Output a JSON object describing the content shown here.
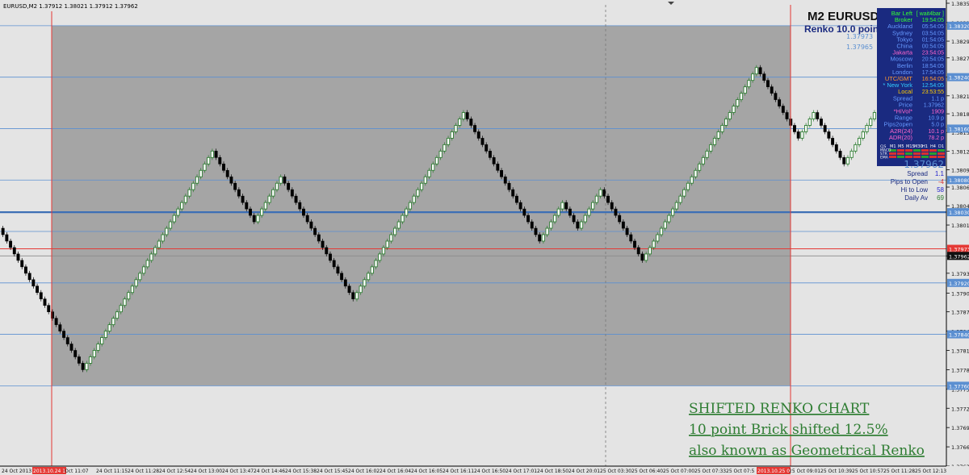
{
  "header": {
    "symbol_line": "EURUSD,M2  1.37912 1.38021 1.37912 1.37962",
    "title": "M2 EURUSD",
    "subtitle": "Renko 10.0 point"
  },
  "annotation": {
    "lines": [
      "SHIFTED RENKO CHART",
      "10 point Brick shifted 12.5%",
      "also known as Geometrical Renko"
    ]
  },
  "info_panel": {
    "rows": [
      {
        "label": "Bar Left",
        "value": "[ wait4bar ]",
        "color": "#33ff33"
      },
      {
        "label": "Broker",
        "value": "19:54:05",
        "color": "#33ff33"
      },
      {
        "label": "Auckland",
        "value": "05:54:05",
        "color": "#6699ff"
      },
      {
        "label": "Sydney",
        "value": "03:54:05",
        "color": "#6699ff"
      },
      {
        "label": "Tokyo",
        "value": "01:54:05",
        "color": "#6699ff"
      },
      {
        "label": "China",
        "value": "00:54:05",
        "color": "#6699ff"
      },
      {
        "label": "Jakarta",
        "value": "23:54:05",
        "color": "#ff66cc"
      },
      {
        "label": "Moscow",
        "value": "20:54:05",
        "color": "#6699ff"
      },
      {
        "label": "Berlin",
        "value": "18:54:05",
        "color": "#6699ff"
      },
      {
        "label": "London",
        "value": "17:54:05",
        "color": "#6699ff"
      },
      {
        "label": "UTC/GMT",
        "value": "16:54:05",
        "color": "#ff9933"
      },
      {
        "label": "* New York",
        "value": "12:54:05",
        "color": "#33ccff"
      },
      {
        "label": "Local",
        "value": "23:53:55",
        "color": "#ffcc00"
      },
      {
        "label": "Spread",
        "value": "1.1 p",
        "color": "#6699ff"
      },
      {
        "label": "Price",
        "value": "1.37962",
        "color": "#6699ff"
      },
      {
        "label": "*HiVol*",
        "value": "1909",
        "color": "#ff66cc"
      },
      {
        "label": "Range",
        "value": "10.9 p",
        "color": "#6699ff"
      },
      {
        "label": "Pips2open",
        "value": "5.0 p",
        "color": "#6699ff"
      },
      {
        "label": "A2R(24)",
        "value": "10.1 p",
        "color": "#ff66cc"
      },
      {
        "label": "ADR(20)",
        "value": "78.2 p",
        "color": "#ff66cc"
      }
    ],
    "timeframes": [
      "M1",
      "M5",
      "M15",
      "M30",
      "H1",
      "H4",
      "D1"
    ],
    "indicators": [
      "CJS",
      "MACD",
      "STR",
      "EMA"
    ],
    "price": "1.37962",
    "stats": [
      {
        "label": "Spread",
        "value": "1.1"
      },
      {
        "label": "Pips to Open",
        "value": "-4"
      },
      {
        "label": "Hi to Low",
        "value": "58"
      },
      {
        "label": "Daily Av",
        "value": "69"
      }
    ],
    "small_prices": [
      "1.37973",
      "1.37965"
    ]
  },
  "colors": {
    "background": "#e4e4e4",
    "shaded": "#a5a5a5",
    "bull_fill": "#ffffff",
    "bull_border": "#2e7d32",
    "bear": "#000000",
    "grid_blue": "#5b8fd1",
    "level_red": "#e53935",
    "annotation": "#2e7d32",
    "panel_bg": "#1a2a80"
  },
  "chart_data": {
    "type": "renko",
    "symbol": "EURUSD",
    "timeframe": "M2",
    "brick_size_points": 10,
    "brick_shift_percent": 12.5,
    "ylim": [
      1.37635,
      1.38355
    ],
    "y_ticks": [
      "1.38355",
      "1.38325",
      "1.38296",
      "1.38270",
      "1.38240",
      "1.38211",
      "1.38183",
      "1.38154",
      "1.38125",
      "1.38096",
      "1.38069",
      "1.38040",
      "1.38010",
      "1.37962",
      "1.37935",
      "1.37904",
      "1.37875",
      "1.37845",
      "1.37815",
      "1.37785",
      "1.37755",
      "1.37725",
      "1.37695",
      "1.37665",
      "1.37635"
    ],
    "y_tick_values": [
      1.38355,
      1.38325,
      1.38296,
      1.3827,
      1.3824,
      1.38211,
      1.38183,
      1.38154,
      1.38125,
      1.38096,
      1.38069,
      1.3804,
      1.3801,
      1.37962,
      1.37935,
      1.37904,
      1.37875,
      1.37845,
      1.37815,
      1.37785,
      1.37755,
      1.37725,
      1.37695,
      1.37665,
      1.37635
    ],
    "x_ticks": [
      "24 Oct 2013",
      "2013.10.24 11:01",
      "Oct 11:07",
      "24 Oct 11:15",
      "24 Oct 11:28",
      "24 Oct 12:54",
      "24 Oct 13:00",
      "24 Oct 13:47",
      "24 Oct 14:46",
      "24 Oct 15:38",
      "24 Oct 15:45",
      "24 Oct 16:02",
      "24 Oct 16:04",
      "24 Oct 16:05",
      "24 Oct 16:11",
      "24 Oct 16:50",
      "24 Oct 17:01",
      "24 Oct 18:50",
      "24 Oct 20:01",
      "25 Oct 03:30",
      "25 Oct 06:40",
      "25 Oct 07:00",
      "25 Oct 07:33",
      "25 Oct 07:5",
      "2013.10.25 08:47",
      "25 Oct 09:01",
      "25 Oct 10:39",
      "25 Oct 10:57",
      "25 Oct 11:28",
      "25 Oct 12:13"
    ],
    "highlighted_x_ticks": [
      "2013.10.24 11:01",
      "2013.10.25 08:47"
    ],
    "gridlines_blue": [
      1.3832,
      1.3824,
      1.3816,
      1.3808,
      1.38,
      1.3792,
      1.3784,
      1.3776
    ],
    "gridline_main": 1.3803,
    "level_red": 1.37973,
    "current_price": 1.37962,
    "price_labels": [
      {
        "value": 1.3832,
        "text": "1.38320"
      },
      {
        "value": 1.3824,
        "text": "1.38240"
      },
      {
        "value": 1.3816,
        "text": "1.38160"
      },
      {
        "value": 1.3808,
        "text": "1.38080"
      },
      {
        "value": 1.3803,
        "text": "1.38030"
      },
      {
        "value": 1.37973,
        "text": "1.37973"
      },
      {
        "value": 1.37962,
        "text": "1.37962"
      },
      {
        "value": 1.3792,
        "text": "1.37920"
      },
      {
        "value": 1.3784,
        "text": "1.37840"
      },
      {
        "value": 1.3776,
        "text": "1.37760"
      }
    ],
    "shaded_region": {
      "price_top": 1.3832,
      "price_bottom": 1.3776
    },
    "brick_sequence": [
      {
        "direction": "down",
        "count": 22
      },
      {
        "direction": "up",
        "count": 34
      },
      {
        "direction": "down",
        "count": 11
      },
      {
        "direction": "up",
        "count": 7
      },
      {
        "direction": "down",
        "count": 19
      },
      {
        "direction": "up",
        "count": 29
      },
      {
        "direction": "down",
        "count": 20
      },
      {
        "direction": "up",
        "count": 6
      },
      {
        "direction": "down",
        "count": 4
      },
      {
        "direction": "up",
        "count": 6
      },
      {
        "direction": "down",
        "count": 11
      },
      {
        "direction": "up",
        "count": 30
      },
      {
        "direction": "down",
        "count": 11
      },
      {
        "direction": "up",
        "count": 4
      },
      {
        "direction": "down",
        "count": 8
      },
      {
        "direction": "up",
        "count": 8
      }
    ]
  }
}
